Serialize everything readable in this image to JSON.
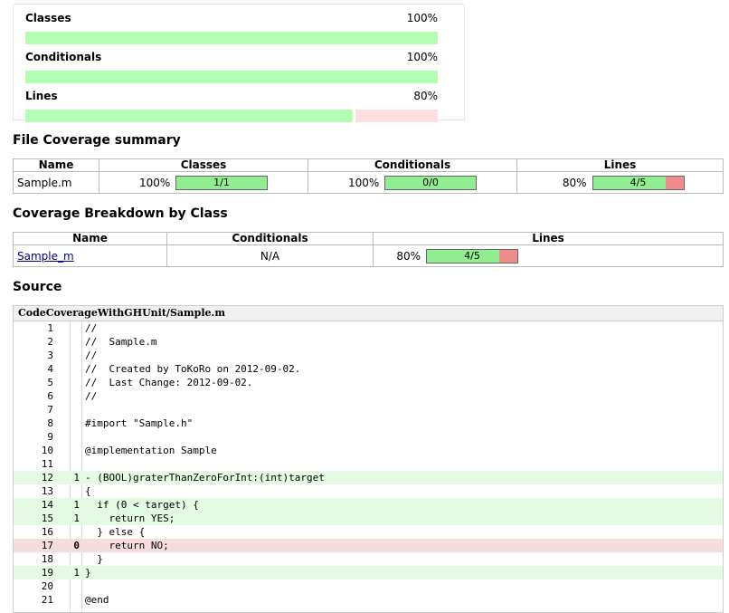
{
  "summary": [
    {
      "label": "Classes",
      "pct": "100%",
      "value": 1.0
    },
    {
      "label": "Conditionals",
      "pct": "100%",
      "value": 1.0
    },
    {
      "label": "Lines",
      "pct": "80%",
      "value": 0.8
    }
  ],
  "file_coverage": {
    "title": "File Coverage summary",
    "headers": [
      "Name",
      "Classes",
      "Conditionals",
      "Lines"
    ],
    "row": {
      "name": "Sample.m",
      "classes": {
        "pct": "100%",
        "text": "1/1",
        "value": 1.0
      },
      "conditionals": {
        "pct": "100%",
        "text": "0/0",
        "value": 1.0
      },
      "lines": {
        "pct": "80%",
        "text": "4/5",
        "value": 0.8
      }
    }
  },
  "class_breakdown": {
    "title": "Coverage Breakdown by Class",
    "headers": [
      "Name",
      "Conditionals",
      "Lines"
    ],
    "row": {
      "name": "Sample_m",
      "conditionals": "N/A",
      "lines": {
        "pct": "80%",
        "text": "4/5",
        "value": 0.8
      }
    }
  },
  "source": {
    "title": "Source",
    "file_path": "CodeCoverageWithGHUnit/Sample.m",
    "lines": [
      {
        "n": "1",
        "hits": "",
        "code": "//",
        "status": ""
      },
      {
        "n": "2",
        "hits": "",
        "code": "//  Sample.m",
        "status": ""
      },
      {
        "n": "3",
        "hits": "",
        "code": "//",
        "status": ""
      },
      {
        "n": "4",
        "hits": "",
        "code": "//  Created by ToKoRo on 2012-09-02.",
        "status": ""
      },
      {
        "n": "5",
        "hits": "",
        "code": "//  Last Change: 2012-09-02.",
        "status": ""
      },
      {
        "n": "6",
        "hits": "",
        "code": "//",
        "status": ""
      },
      {
        "n": "7",
        "hits": "",
        "code": "",
        "status": ""
      },
      {
        "n": "8",
        "hits": "",
        "code": "#import \"Sample.h\"",
        "status": ""
      },
      {
        "n": "9",
        "hits": "",
        "code": "",
        "status": ""
      },
      {
        "n": "10",
        "hits": "",
        "code": "@implementation Sample",
        "status": ""
      },
      {
        "n": "11",
        "hits": "",
        "code": "",
        "status": ""
      },
      {
        "n": "12",
        "hits": "1",
        "code": "- (BOOL)graterThanZeroForInt:(int)target",
        "status": "hit"
      },
      {
        "n": "13",
        "hits": "",
        "code": "{",
        "status": ""
      },
      {
        "n": "14",
        "hits": "1",
        "code": "  if (0 < target) {",
        "status": "hit"
      },
      {
        "n": "15",
        "hits": "1",
        "code": "    return YES;",
        "status": "hit"
      },
      {
        "n": "16",
        "hits": "",
        "code": "  } else {",
        "status": ""
      },
      {
        "n": "17",
        "hits": "0",
        "code": "    return NO;",
        "status": "miss"
      },
      {
        "n": "18",
        "hits": "",
        "code": "  }",
        "status": ""
      },
      {
        "n": "19",
        "hits": "1",
        "code": "}",
        "status": "hit"
      },
      {
        "n": "20",
        "hits": "",
        "code": "",
        "status": ""
      },
      {
        "n": "21",
        "hits": "",
        "code": "@end",
        "status": ""
      }
    ]
  },
  "colors": {
    "covered": "#90ee90",
    "uncovered": "#f08c8c",
    "hit_row": "#e2fbe2",
    "miss_row": "#f6dddd"
  }
}
